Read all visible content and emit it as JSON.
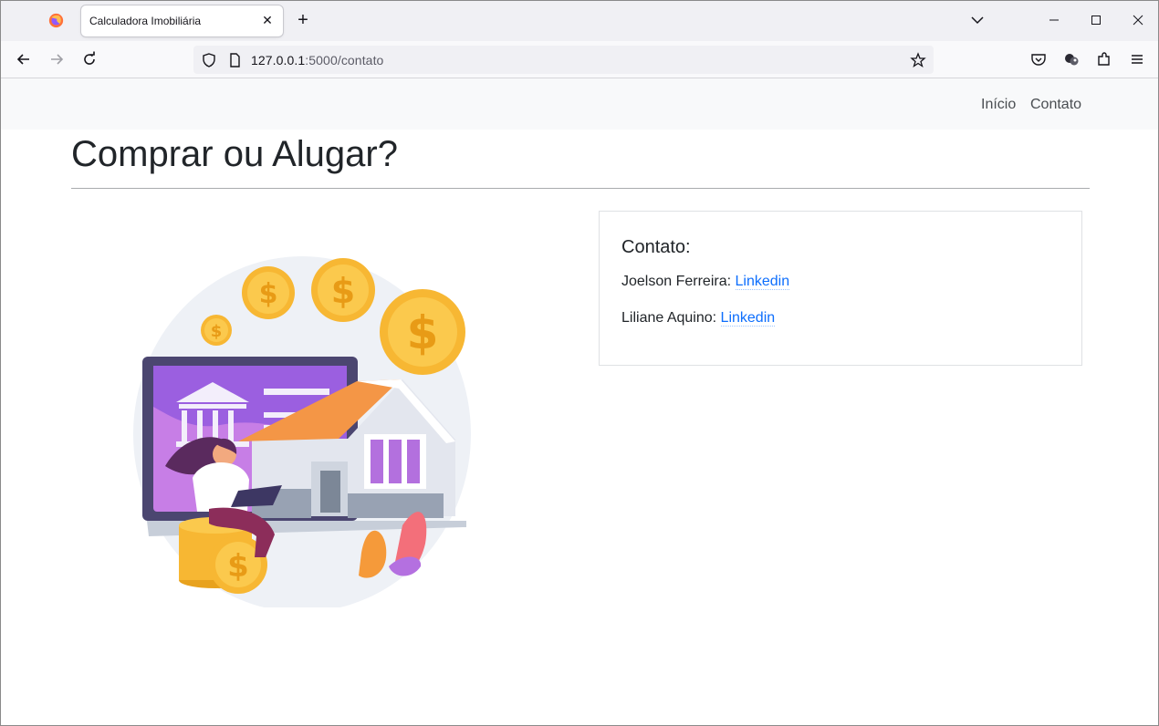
{
  "browser": {
    "tab_title": "Calculadora Imobiliária",
    "tab_close": "✕",
    "new_tab": "+",
    "url_host": "127.0.0.1",
    "url_rest": ":5000/contato"
  },
  "nav": {
    "items": [
      {
        "label": "Início"
      },
      {
        "label": "Contato"
      }
    ]
  },
  "page": {
    "title": "Comprar ou Alugar?"
  },
  "contact_card": {
    "title": "Contato:",
    "entries": [
      {
        "name": "Joelson Ferreira:",
        "link_label": "Linkedin"
      },
      {
        "name": "Liliane Aquino:",
        "link_label": "Linkedin"
      }
    ]
  },
  "icons": {
    "browser": [
      "firefox-logo-icon",
      "tab-close-icon",
      "new-tab-icon",
      "list-all-tabs-icon",
      "minimize-icon",
      "maximize-icon",
      "close-window-icon",
      "back-icon",
      "forward-icon",
      "reload-icon",
      "tracking-shield-icon",
      "page-info-icon",
      "bookmark-star-icon",
      "pocket-icon",
      "extension-profile-icon",
      "extensions-icon",
      "menu-icon"
    ]
  },
  "colors": {
    "link": "#0d6efd",
    "navbar_bg": "#f8f9fa",
    "accent_purple": "#a45de2",
    "coin_gold": "#f7b733"
  }
}
